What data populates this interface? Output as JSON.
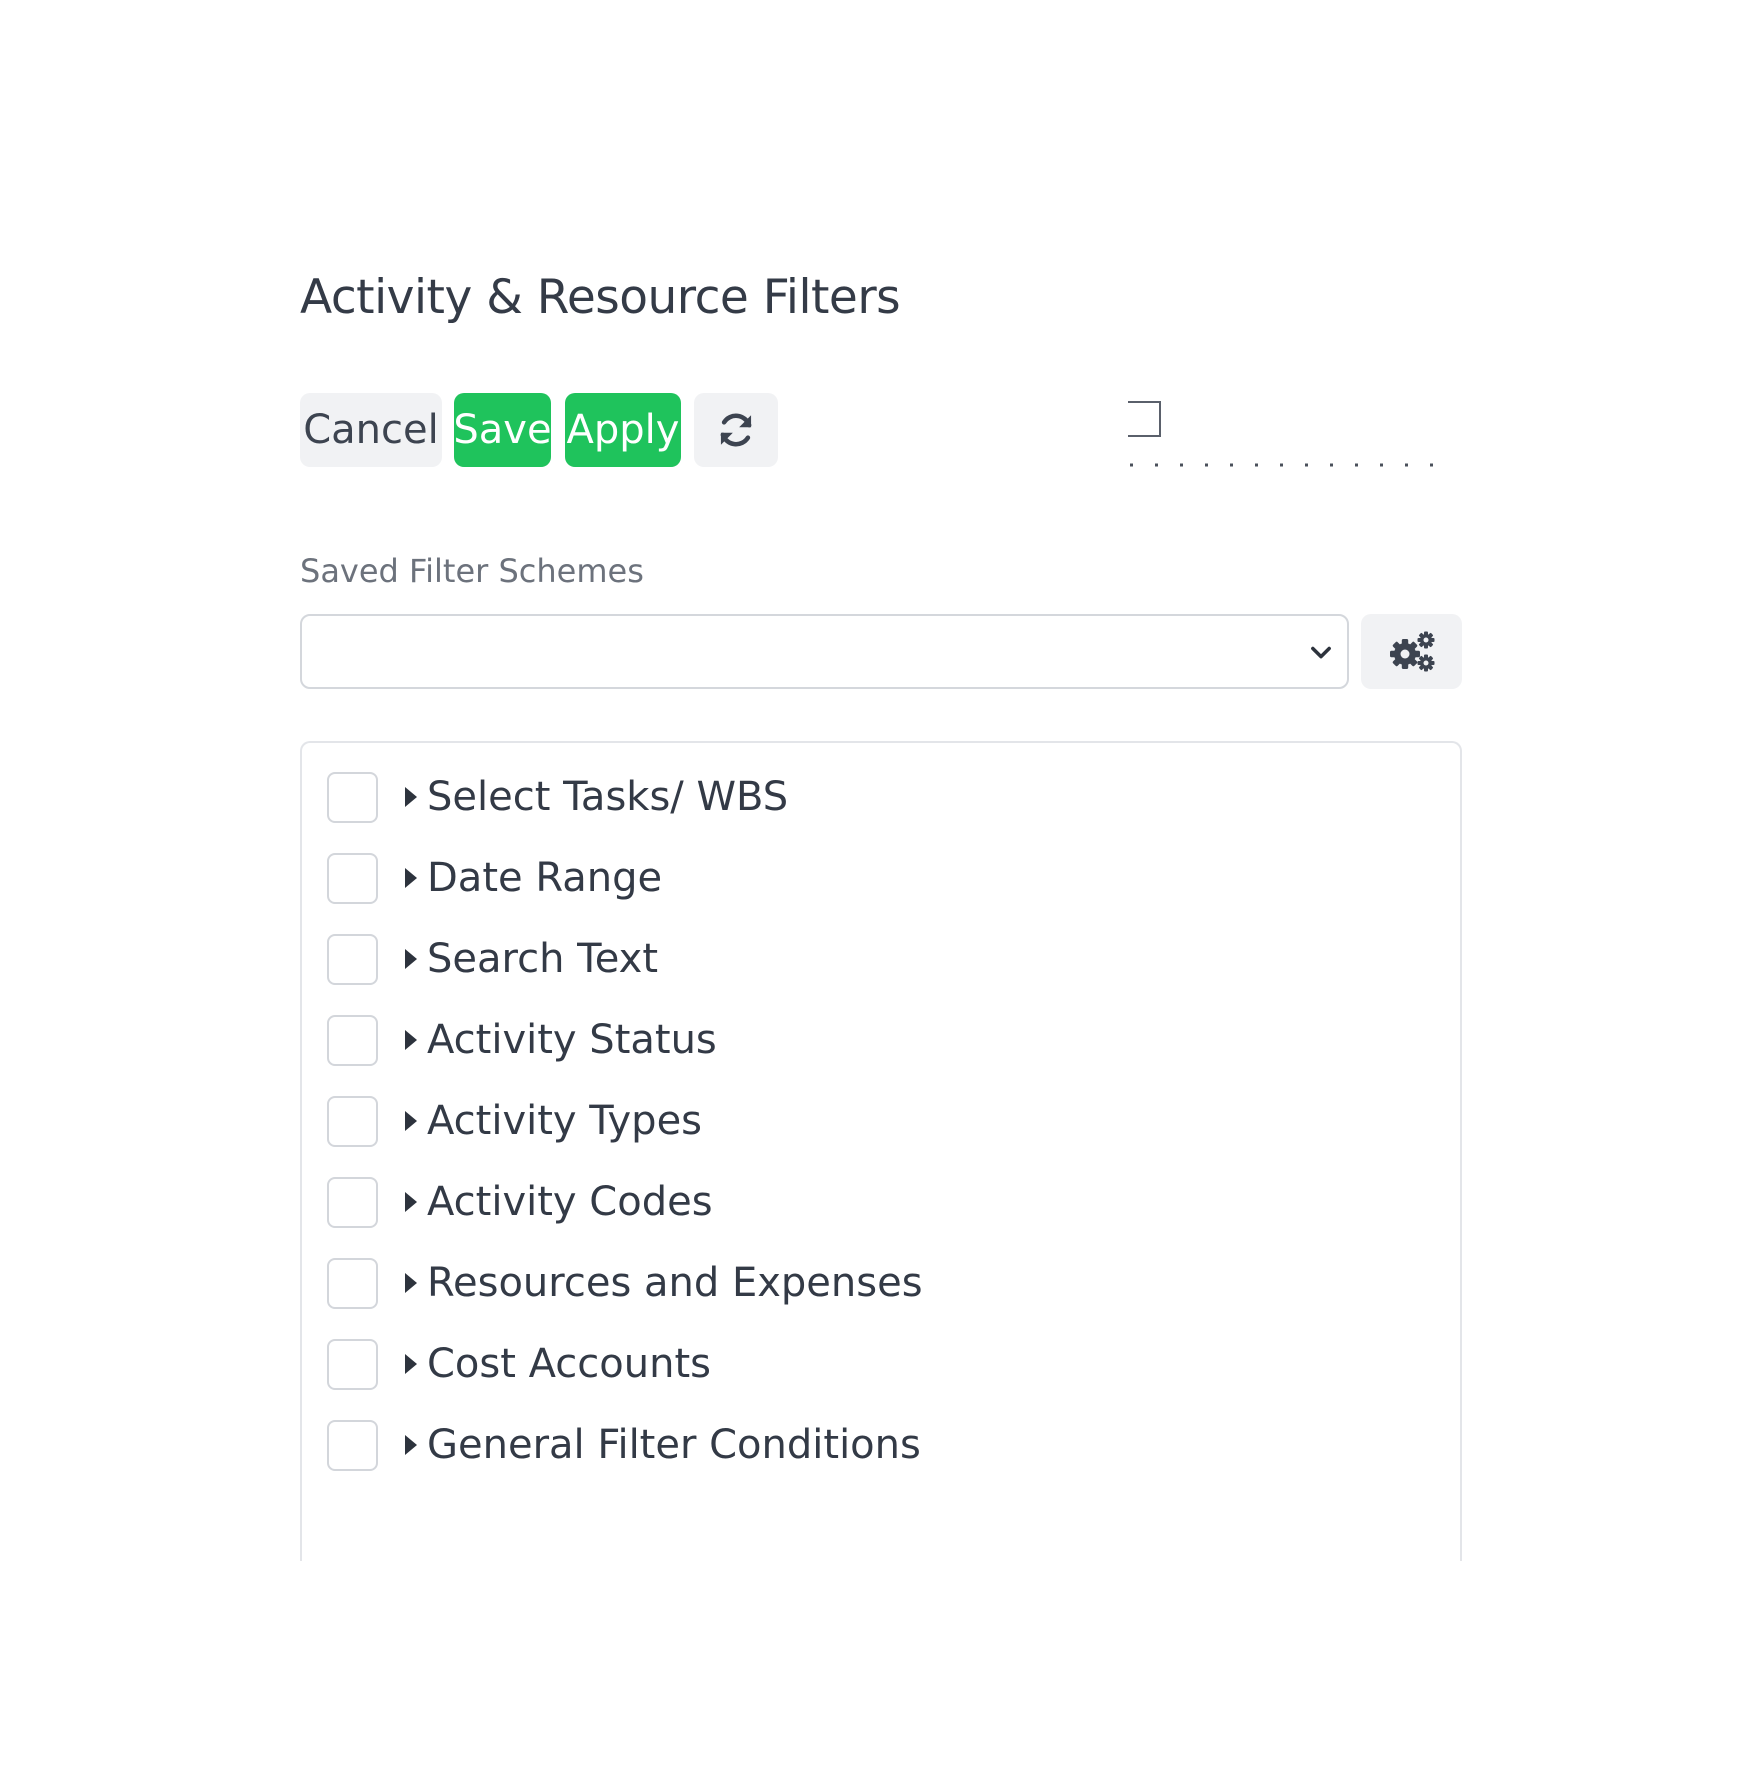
{
  "page": {
    "title": "Activity & Resource Filters"
  },
  "toolbar": {
    "cancel_label": "Cancel",
    "save_label": "Save",
    "apply_label": "Apply",
    "refresh_icon": "refresh-icon"
  },
  "colors": {
    "accent_green": "#1fc35c",
    "button_gray": "#f1f2f4",
    "text_dark": "#333a46",
    "label_gray": "#6c727c",
    "border_gray": "#d4d7dc"
  },
  "saved_schemes": {
    "label": "Saved Filter Schemes",
    "selected_value": "",
    "settings_icon": "gears-icon"
  },
  "filters": {
    "items": [
      {
        "label": "Select Tasks/ WBS",
        "checked": false
      },
      {
        "label": "Date Range",
        "checked": false
      },
      {
        "label": "Search Text",
        "checked": false
      },
      {
        "label": "Activity Status",
        "checked": false
      },
      {
        "label": "Activity Types",
        "checked": false
      },
      {
        "label": "Activity Codes",
        "checked": false
      },
      {
        "label": "Resources and Expenses",
        "checked": false
      },
      {
        "label": "Cost Accounts",
        "checked": false
      },
      {
        "label": "General Filter Conditions",
        "checked": false
      }
    ]
  }
}
